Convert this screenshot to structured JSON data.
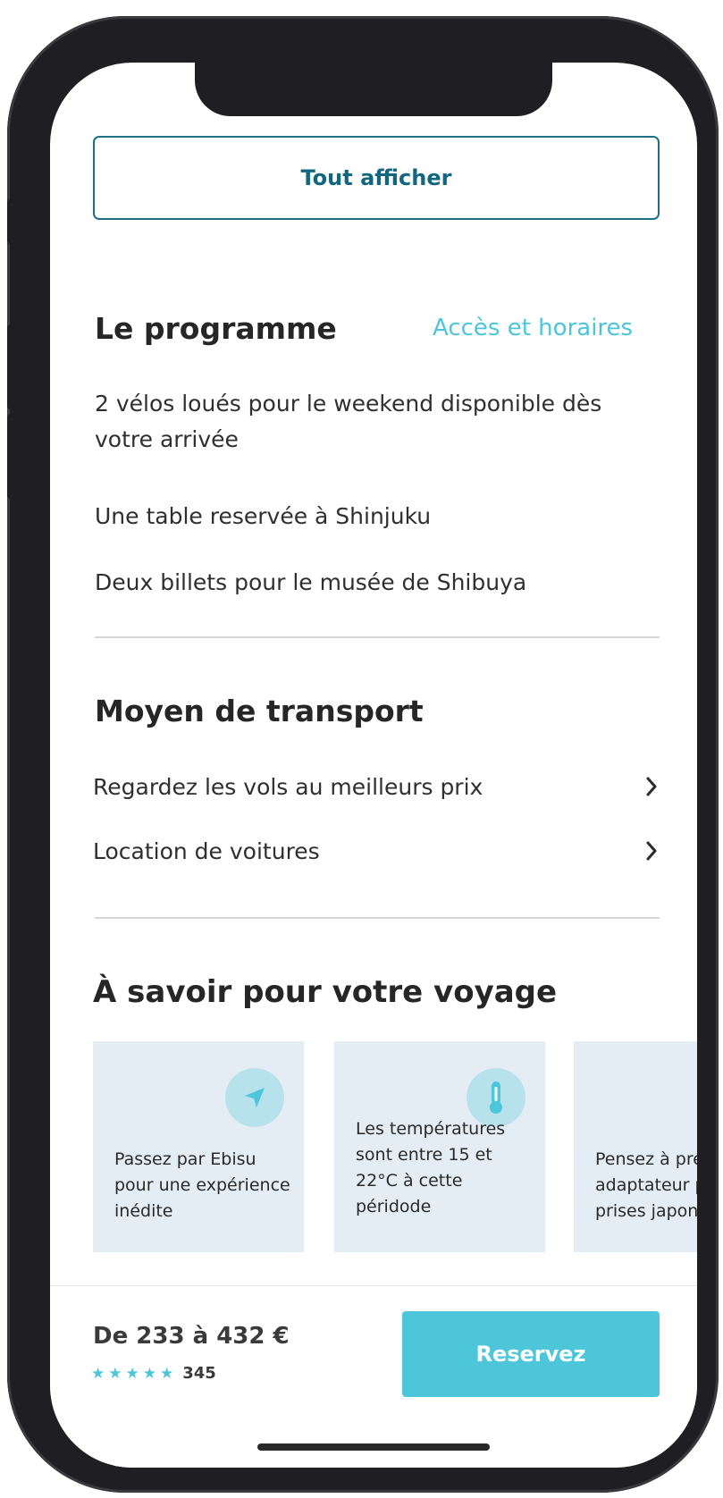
{
  "show_all": {
    "label": "Tout afficher"
  },
  "program": {
    "title": "Le programme",
    "access_link": "Accès et horaires",
    "items": [
      "2 vélos loués pour le weekend disponible dès votre arrivée",
      "Une table reservée à Shinjuku",
      "Deux billets pour le musée de Shibuya"
    ]
  },
  "transport": {
    "title": "Moyen de transport",
    "items": [
      "Regardez les vols au meilleurs prix",
      "Location de voitures"
    ]
  },
  "trip_info": {
    "title": "À savoir pour votre voyage",
    "cards": [
      {
        "icon": "navigation-arrow-icon",
        "text": "Passez par Ebisu pour une expérience inédite"
      },
      {
        "icon": "thermometer-icon",
        "text": "Les températures sont entre 15 et 22°C à cette péridode"
      },
      {
        "icon": "",
        "text": "Pensez à prendre un adaptateur pour les prises japonaises"
      }
    ]
  },
  "footer": {
    "price": "De 233 à 432 €",
    "rating_stars": 5,
    "rating_count": "345",
    "book_label": "Reservez"
  },
  "colors": {
    "accent": "#4ec6da",
    "primary_dark": "#12667f",
    "card_bg": "#e3edf3",
    "icon_bg": "#b7e2ec",
    "text": "#2f2f2f"
  }
}
